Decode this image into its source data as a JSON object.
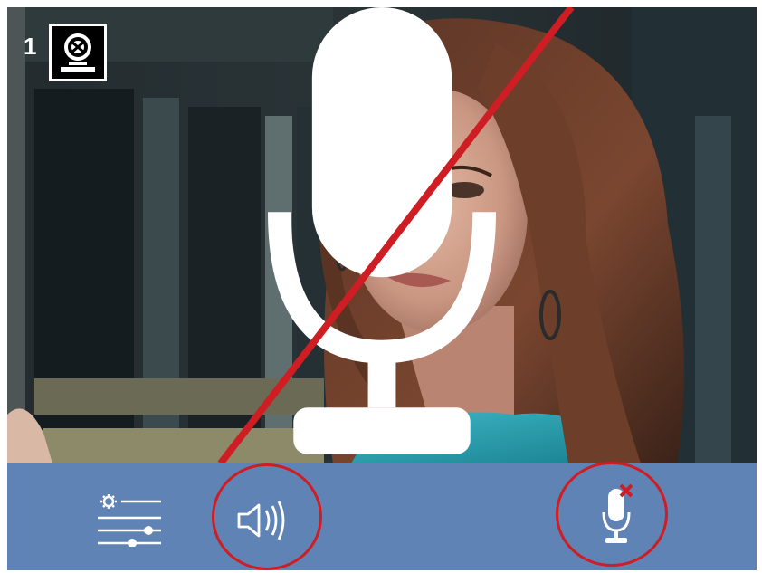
{
  "camera": {
    "number": "1",
    "badge_icon": "entrance-panel-camera-icon",
    "status_icon": "microphone-icon"
  },
  "controls": {
    "settings_icon": "settings-sliders-icon",
    "speaker_icon": "speaker-volume-icon",
    "mic_mute_icon": "microphone-muted-icon"
  },
  "colors": {
    "control_bar": "#5e83b4",
    "highlight": "#cf1d24",
    "icon": "#ffffff"
  }
}
